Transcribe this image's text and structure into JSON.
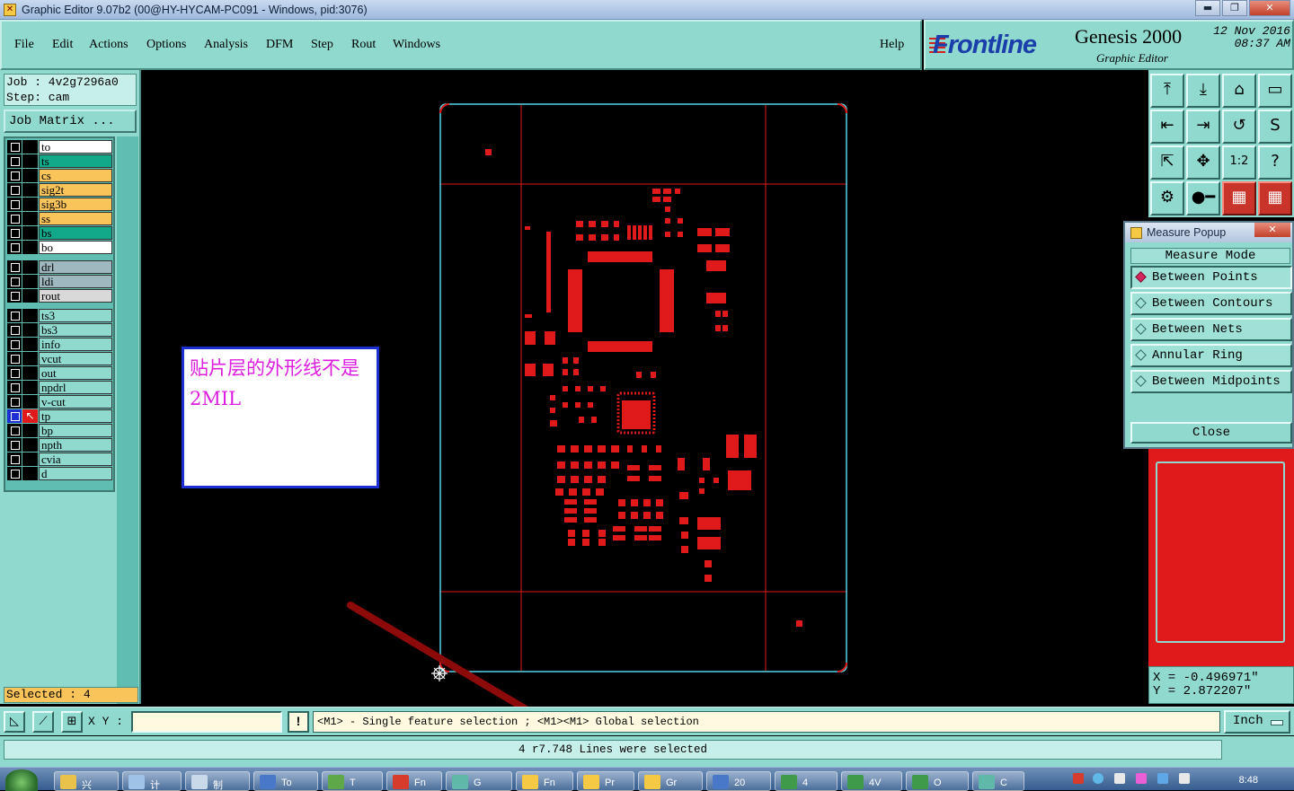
{
  "window": {
    "title": "Graphic Editor 9.07b2 (00@HY-HYCAM-PC091 - Windows, pid:3076)",
    "minimize": "▬",
    "restore": "❐",
    "close": "✕"
  },
  "menu": [
    {
      "label": "File"
    },
    {
      "label": "Edit"
    },
    {
      "label": "Actions"
    },
    {
      "label": "Options"
    },
    {
      "label": "Analysis"
    },
    {
      "label": "DFM"
    },
    {
      "label": "Step"
    },
    {
      "label": "Rout"
    },
    {
      "label": "Windows"
    }
  ],
  "help_label": "Help",
  "brand": {
    "logo": "Frontline",
    "product": "Genesis 2000",
    "subtitle": "Graphic Editor",
    "date": "12 Nov 2016",
    "time": "08:37 AM"
  },
  "job": {
    "job_line": "Job : 4v2g7296a0",
    "step_line": "Step: cam",
    "matrix_button": "Job Matrix ..."
  },
  "layers": [
    {
      "name": "to",
      "color": "#ffffff"
    },
    {
      "name": "ts",
      "color": "#12a88a"
    },
    {
      "name": "cs",
      "color": "#f9c45a"
    },
    {
      "name": "sig2t",
      "color": "#f9c45a"
    },
    {
      "name": "sig3b",
      "color": "#f9c45a"
    },
    {
      "name": "ss",
      "color": "#f9c45a"
    },
    {
      "name": "bs",
      "color": "#12a88a"
    },
    {
      "name": "bo",
      "color": "#ffffff"
    },
    {
      "name": "drl",
      "color": "#9fb8c0"
    },
    {
      "name": "ldi",
      "color": "#9fb8c0"
    },
    {
      "name": "rout",
      "color": "#d9d9d9"
    },
    {
      "name": "ts3",
      "color": "#8fd9cf"
    },
    {
      "name": "bs3",
      "color": "#8fd9cf"
    },
    {
      "name": "info",
      "color": "#8fd9cf"
    },
    {
      "name": "vcut",
      "color": "#8fd9cf"
    },
    {
      "name": "out",
      "color": "#8fd9cf"
    },
    {
      "name": "npdrl",
      "color": "#8fd9cf"
    },
    {
      "name": "v-cut",
      "color": "#8fd9cf"
    },
    {
      "name": "tp",
      "color": "#8fd9cf",
      "active": true
    },
    {
      "name": "bp",
      "color": "#8fd9cf"
    },
    {
      "name": "npth",
      "color": "#8fd9cf"
    },
    {
      "name": "cvia",
      "color": "#8fd9cf"
    },
    {
      "name": "d",
      "color": "#8fd9cf"
    }
  ],
  "selected_count": "Selected : 4",
  "note": {
    "text": "贴片层的外形线不是2MIL"
  },
  "tools": [
    {
      "icon": "⤒"
    },
    {
      "icon": "⤓"
    },
    {
      "icon": "⌂"
    },
    {
      "icon": "▭"
    },
    {
      "icon": "⇤"
    },
    {
      "icon": "⇥"
    },
    {
      "icon": "↺"
    },
    {
      "icon": "S"
    },
    {
      "icon": "⇱"
    },
    {
      "icon": "✥"
    },
    {
      "icon": "1:2"
    },
    {
      "icon": "?"
    },
    {
      "icon": "⚙"
    },
    {
      "icon": "●━"
    },
    {
      "icon": "▦",
      "red": true
    },
    {
      "icon": "▦",
      "red": true
    }
  ],
  "measure": {
    "title": "Measure Popup",
    "mode_label": "Measure Mode",
    "options": [
      {
        "label": "Between Points",
        "selected": true
      },
      {
        "label": "Between Contours"
      },
      {
        "label": "Between Nets"
      },
      {
        "label": "Annular Ring"
      },
      {
        "label": "Between Midpoints"
      }
    ],
    "close_label": "Close"
  },
  "coords": {
    "x": "X = -0.496971\"",
    "y": "Y = 2.872207\""
  },
  "command": {
    "xy_label": "X Y :",
    "xy_value": "",
    "hint": "<M1> - Single feature selection ; <M1><M1> Global selection",
    "unit": "Inch"
  },
  "status_message": "4 r7.748 Lines were selected",
  "taskbar": {
    "items": [
      {
        "label": "兴",
        "color": "#e8c24a"
      },
      {
        "label": "计",
        "color": "#9fc3e8"
      },
      {
        "label": "制",
        "color": "#c9d9ea"
      },
      {
        "label": "To",
        "color": "#4a78c8"
      },
      {
        "label": "T",
        "color": "#5fa84a"
      },
      {
        "label": "Fn",
        "color": "#d63b2b"
      },
      {
        "label": "G",
        "color": "#5fb8a8"
      },
      {
        "label": "Fn",
        "color": "#f6c945"
      },
      {
        "label": "Pr",
        "color": "#f6c945"
      },
      {
        "label": "Gr",
        "color": "#f6c945"
      },
      {
        "label": "20",
        "color": "#4a78c8"
      },
      {
        "label": "4",
        "color": "#3f9a4a"
      },
      {
        "label": "4V",
        "color": "#3f9a4a"
      },
      {
        "label": "O",
        "color": "#3f9a4a"
      },
      {
        "label": "C",
        "color": "#5fb8a8"
      }
    ],
    "clock": "8:48"
  }
}
